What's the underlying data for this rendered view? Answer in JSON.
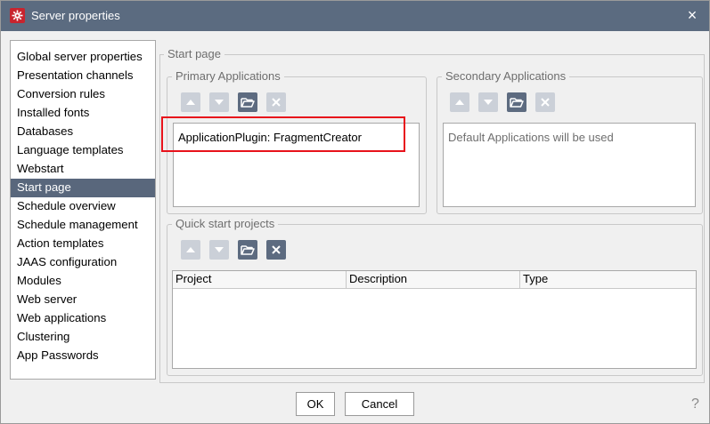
{
  "window": {
    "title": "Server properties",
    "close_glyph": "×"
  },
  "sidebar": {
    "items": [
      {
        "label": "Global server properties"
      },
      {
        "label": "Presentation channels"
      },
      {
        "label": "Conversion rules"
      },
      {
        "label": "Installed fonts"
      },
      {
        "label": "Databases"
      },
      {
        "label": "Language templates"
      },
      {
        "label": "Webstart"
      },
      {
        "label": "Start page",
        "selected": true
      },
      {
        "label": "Schedule overview"
      },
      {
        "label": "Schedule management"
      },
      {
        "label": "Action templates"
      },
      {
        "label": "JAAS configuration"
      },
      {
        "label": "Modules"
      },
      {
        "label": "Web server"
      },
      {
        "label": "Web applications"
      },
      {
        "label": "Clustering"
      },
      {
        "label": "App Passwords"
      }
    ]
  },
  "start_page": {
    "title": "Start page",
    "primary": {
      "title": "Primary Applications",
      "items": [
        "ApplicationPlugin: FragmentCreator"
      ],
      "buttons": [
        "move-up",
        "move-down",
        "open",
        "remove"
      ]
    },
    "secondary": {
      "title": "Secondary Applications",
      "placeholder": "Default Applications will be used",
      "buttons": [
        "move-up",
        "move-down",
        "open",
        "remove"
      ]
    },
    "quick_start": {
      "title": "Quick start projects",
      "columns": [
        "Project",
        "Description",
        "Type"
      ],
      "buttons": [
        "move-up",
        "move-down",
        "open",
        "remove"
      ]
    }
  },
  "footer": {
    "ok_label": "OK",
    "cancel_label": "Cancel",
    "help_glyph": "?"
  },
  "colors": {
    "titlebar": "#5b6b80",
    "selection": "#59677c",
    "highlight": "#e8121b",
    "app_icon": "#c8242e"
  }
}
